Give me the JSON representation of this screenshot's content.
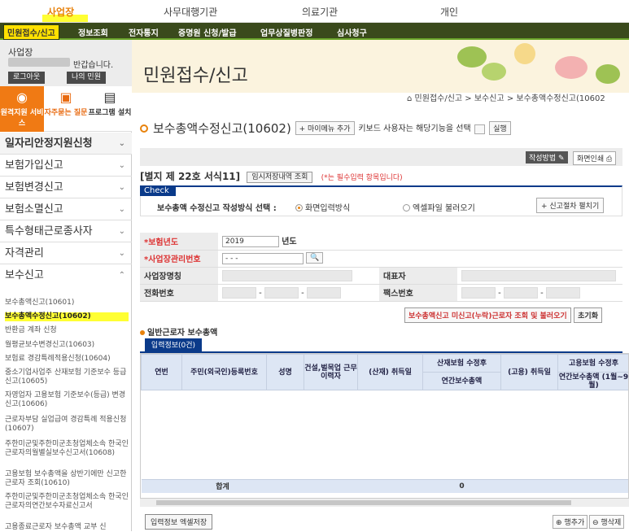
{
  "top_nav": [
    "사업장",
    "사무대행기관",
    "의료기관",
    "개인"
  ],
  "sub_nav": [
    "민원접수/신고",
    "정보조회",
    "전자통지",
    "증명원 신청/발급",
    "업무상질병판정",
    "심사청구"
  ],
  "user": {
    "org": "사업장",
    "greeting": "반갑습니다.",
    "logout": "로그아웃",
    "mypage": "나의 민원"
  },
  "quick": [
    "원격지원 서비스",
    "자주묻는 질문",
    "프로그램 설치"
  ],
  "sidebar": {
    "menus": [
      "일자리안정지원신청",
      "보험가입신고",
      "보험변경신고",
      "보험소멸신고",
      "특수형태근로종사자",
      "자격관리",
      "보수신고"
    ],
    "sub_items": [
      "보수총액신고(10601)",
      "보수총액수정신고(10602)",
      "반환금 계좌 신청",
      "월평균보수변경신고(10603)",
      "보험료 경감특례적용신청(10604)",
      "중소기업사업주 산재보험 기준보수 등급신고(10605)",
      "자영업자 고용보험 기준보수(등급) 변경신고(10606)",
      "근로자부담 실업급여 경감특례 적용신청(10607)",
      "주한미군및주한미군초청업체소속 한국인근로자의월별실보수신고서(10608)",
      "고용보험 보수총액을 상반기에만 신고한 근로자 조회(10610)",
      "주한미군및주한미군초청업체소속 한국인근로자의연간보수자료신고서",
      "고용종료근로자 보수총액 교부 신"
    ]
  },
  "banner_title": "민원접수/신고",
  "breadcrumb": "민원접수/신고 > 보수신고 > 보수총액수정신고(10602",
  "page": {
    "title": "보수총액수정신고(10602)",
    "mymenu_btn": "+ 마이메뉴 추가",
    "kb_text": "키보드 사용자는 해당기능을 선택",
    "run_btn": "실행",
    "guide_btn": "작성방법",
    "print_btn": "화면인쇄",
    "form_label": "[별지 제 22호 서식11]",
    "temp_save_btn": "임시저장내역 조회",
    "required_note": "(*는 필수입력 항목입니다)",
    "check_tag": "Check",
    "method_label": "보수총액 수정신고 작성방식 선택 :",
    "radio_screen": "화면입력방식",
    "radio_excel": "엑셀파일 불러오기",
    "ref_btn": "+ 신고절차 펼치기"
  },
  "info": {
    "year_label": "*보험년도",
    "year_value": "2019",
    "year_unit": "년도",
    "biz_no_label": "*사업장관리번호",
    "biz_no_value": "-  -  -",
    "biz_name_label": "사업장명칭",
    "rep_label": "대표자",
    "phone_label": "전화번호",
    "fax_label": "팩스번호"
  },
  "actions": {
    "lookup": "보수총액신고 미신고(누락)근로자 조회 및 불러오기",
    "reset": "초기화"
  },
  "section_title": "일반근로자 보수총액",
  "tab_label": "입력정보(0건)",
  "grid": {
    "headers": [
      "연번",
      "주민(외국인)등록번호",
      "성명",
      "건설,벌목업 근무이력자",
      "(산재) 취득일",
      "산재보험 수정후",
      "연간보수총액",
      "(고용) 취득일",
      "고용보험 수정후",
      "연간보수총액 (1월~9월)"
    ],
    "sum_label": "합계",
    "sum_value": "0"
  },
  "bottom": {
    "excel_btn": "입력정보 엑셀저장",
    "add_row": "행추가",
    "del_row": "행삭제"
  }
}
